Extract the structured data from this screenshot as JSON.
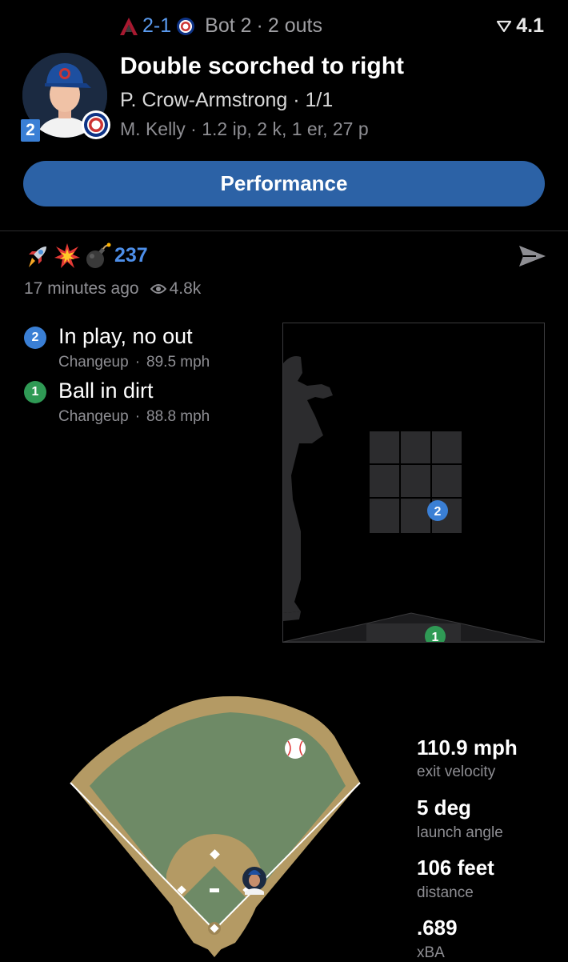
{
  "header": {
    "away_score": "2-1",
    "inning": "Bot 2",
    "separator": "·",
    "outs": "2 outs",
    "app_version": "4.1",
    "headline": "Double scorched to right",
    "batter": "P. Crow-Armstrong · 1/1",
    "pitcher": "M. Kelly · 1.2 ip, 2 k, 1 er, 27 p",
    "batting_order": "2",
    "performance_button": "Performance"
  },
  "reactions": {
    "count": "237",
    "time_ago": "17 minutes ago",
    "views": "4.8k",
    "emojis": [
      "rocket-icon",
      "collision-icon",
      "bomb-icon"
    ]
  },
  "pitches": [
    {
      "num": "2",
      "result": "In play, no out",
      "type": "Changeup",
      "speed": "89.5 mph",
      "color": "#3a7fd5"
    },
    {
      "num": "1",
      "result": "Ball in dirt",
      "type": "Changeup",
      "speed": "88.8 mph",
      "color": "#2f9a55"
    }
  ],
  "zone": {
    "pitch_2_label": "2",
    "pitch_1_label": "1"
  },
  "stats": [
    {
      "value": "110.9 mph",
      "label": "exit velocity"
    },
    {
      "value": "5 deg",
      "label": "launch angle"
    },
    {
      "value": "106 feet",
      "label": "distance"
    },
    {
      "value": ".689",
      "label": "xBA"
    }
  ],
  "colors": {
    "accent_blue": "#2c62a6",
    "score_blue": "#5a9bf0",
    "field_grass": "#6e8a66",
    "field_dirt": "#b49a64"
  }
}
